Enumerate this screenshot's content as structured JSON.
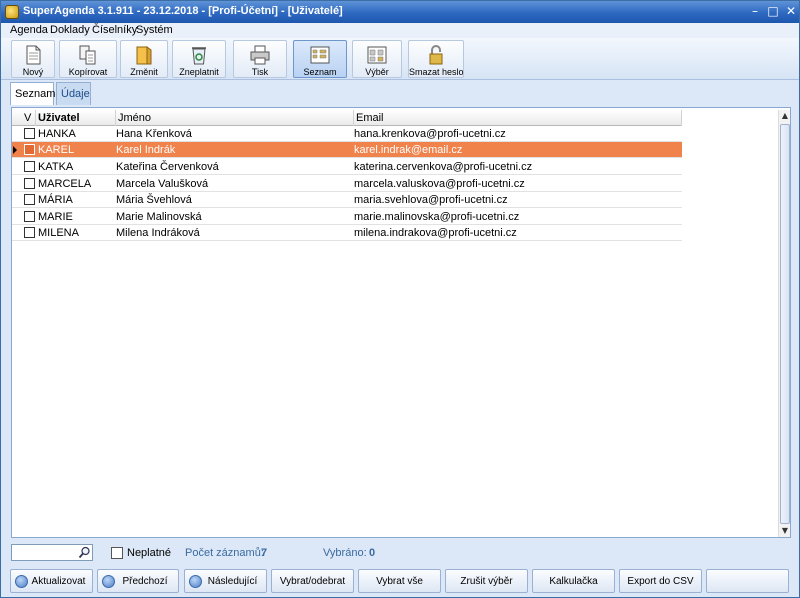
{
  "window": {
    "title": "SuperAgenda 3.1.911 - 23.12.2018 - [Profi-Účetní] - [Uživatelé]"
  },
  "menu": [
    "Agenda",
    "Doklady",
    "Číselníky",
    "Systém"
  ],
  "toolbar": [
    {
      "label": "Nový",
      "icon": "new-document-icon"
    },
    {
      "label": "Kopírovat",
      "icon": "copy-icon"
    },
    {
      "label": "Změnit",
      "icon": "edit-icon"
    },
    {
      "label": "Zneplatnit",
      "icon": "recycle-bin-icon"
    },
    {
      "label": "Tisk",
      "icon": "printer-icon"
    },
    {
      "label": "Seznam",
      "icon": "list-view-icon",
      "active": true
    },
    {
      "label": "Výběr",
      "icon": "selection-icon"
    },
    {
      "label": "Smazat heslo",
      "icon": "padlock-icon"
    }
  ],
  "tabs": [
    {
      "label": "Seznam",
      "active": true
    },
    {
      "label": "Údaje",
      "active": false
    }
  ],
  "grid": {
    "columns": [
      "V",
      "Uživatel",
      "Jméno",
      "Email"
    ],
    "rows": [
      {
        "user": "HANKA",
        "name": "Hana Křenková",
        "email": "hana.krenkova@profi-ucetni.cz",
        "selected": false
      },
      {
        "user": "KAREL",
        "name": "Karel Indrák",
        "email": "karel.indrak@email.cz",
        "selected": true
      },
      {
        "user": "KATKA",
        "name": "Kateřina Červenková",
        "email": "katerina.cervenkova@profi-ucetni.cz",
        "selected": false
      },
      {
        "user": "MARCELA",
        "name": "Marcela Valušková",
        "email": "marcela.valuskova@profi-ucetni.cz",
        "selected": false
      },
      {
        "user": "MÁRIA",
        "name": "Mária Švehlová",
        "email": "maria.svehlova@profi-ucetni.cz",
        "selected": false
      },
      {
        "user": "MARIE",
        "name": "Marie Malinovská",
        "email": "marie.malinovska@profi-ucetni.cz",
        "selected": false
      },
      {
        "user": "MILENA",
        "name": "Milena Indráková",
        "email": "milena.indrakova@profi-ucetni.cz",
        "selected": false
      }
    ],
    "selection_color": "#f0824c"
  },
  "filter": {
    "search_value": "",
    "invalid_label": "Neplatné",
    "count_label": "Počet záznamů:",
    "count_value": "7",
    "selected_label": "Vybráno:",
    "selected_value": "0"
  },
  "buttons": [
    {
      "label": "Aktualizovat",
      "icon": "refresh-icon"
    },
    {
      "label": "Předchozí",
      "icon": "arrow-up-icon"
    },
    {
      "label": "Následující",
      "icon": "arrow-down-icon"
    },
    {
      "label": "Vybrat/odebrat"
    },
    {
      "label": "Vybrat vše"
    },
    {
      "label": "Zrušit výběr"
    },
    {
      "label": "Kalkulačka"
    },
    {
      "label": "Export do CSV"
    },
    {
      "label": ""
    }
  ]
}
